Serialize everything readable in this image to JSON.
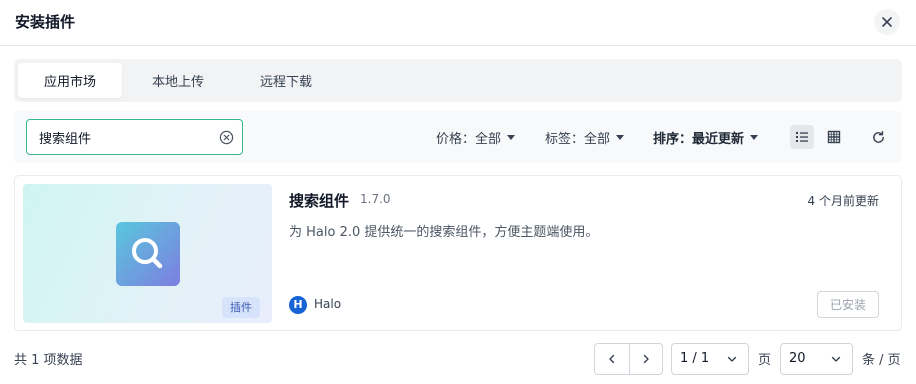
{
  "dialog": {
    "title": "安装插件",
    "close_icon": "close-icon"
  },
  "tabs": [
    {
      "label": "应用市场",
      "active": true
    },
    {
      "label": "本地上传",
      "active": false
    },
    {
      "label": "远程下载",
      "active": false
    }
  ],
  "toolbar": {
    "search_value": "搜索组件",
    "clear_icon": "clear-circle-icon",
    "price_label": "价格：",
    "price_value": "全部",
    "tag_label": "标签：",
    "tag_value": "全部",
    "sort_label": "排序：",
    "sort_value": "最近更新",
    "list_view_icon": "list-view-icon",
    "grid_view_icon": "grid-view-icon",
    "refresh_icon": "refresh-icon"
  },
  "plugin": {
    "name": "搜索组件",
    "version": "1.7.0",
    "updated": "4 个月前更新",
    "description": "为 Halo 2.0 提供统一的搜索组件，方便主题端使用。",
    "badge": "插件",
    "author": "Halo",
    "author_logo_letter": "H",
    "install_status": "已安装",
    "logo_icon": "search-magnifier-icon"
  },
  "pagination": {
    "total": "共 1 项数据",
    "page": "1 / 1",
    "page_label": "页",
    "page_size": "20",
    "size_label": "条 / 页",
    "prev_icon": "chevron-left-icon",
    "next_icon": "chevron-right-icon"
  },
  "colors": {
    "accent": "#34b98e",
    "badge_bg": "#d7e3fb",
    "author_blue": "#1763d6"
  }
}
